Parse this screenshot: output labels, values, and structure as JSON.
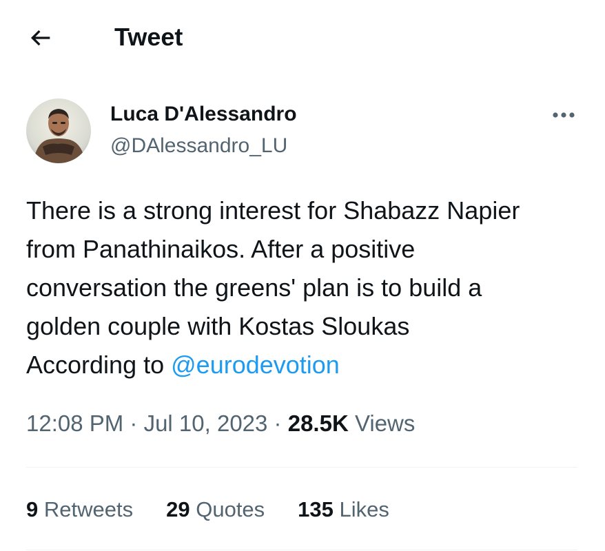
{
  "header": {
    "title": "Tweet",
    "back_icon": "arrow-left-icon"
  },
  "author": {
    "name": "Luca D'Alessandro",
    "handle": "@DAlessandro_LU",
    "more_icon": "more-horizontal-icon"
  },
  "tweet": {
    "lines": [
      "There is a strong interest for Shabazz Napier",
      "from Panathinaikos. After a positive",
      "conversation the greens' plan is to build a",
      "golden couple with Kostas Sloukas"
    ],
    "last_line_prefix": "According to ",
    "mention": "@eurodevotion"
  },
  "meta": {
    "time": "12:08 PM",
    "separator": " · ",
    "date": "Jul 10, 2023",
    "views_count": "28.5K",
    "views_label": "Views"
  },
  "stats": {
    "retweets_count": "9",
    "retweets_label": "Retweets",
    "quotes_count": "29",
    "quotes_label": "Quotes",
    "likes_count": "135",
    "likes_label": "Likes"
  },
  "colors": {
    "text": "#0f1419",
    "secondary": "#536471",
    "link": "#1d9bf0",
    "divider": "#eff3f4"
  }
}
